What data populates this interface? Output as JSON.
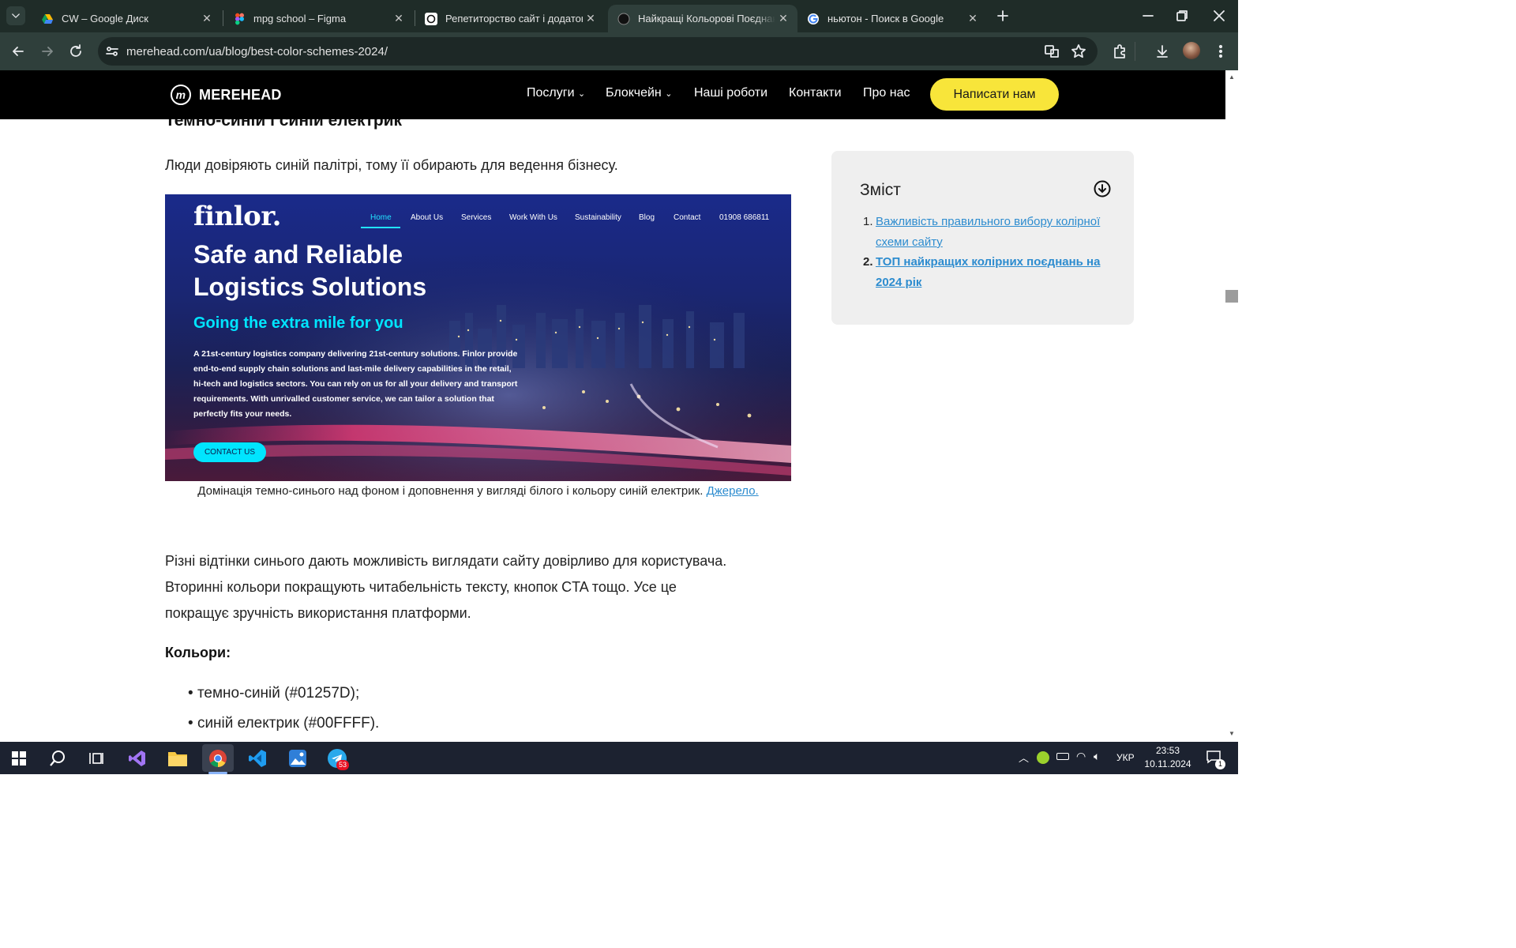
{
  "browser": {
    "tabs": [
      {
        "title": "CW – Google Диск",
        "icon": "google-drive-icon"
      },
      {
        "title": "mpg school – Figma",
        "icon": "figma-icon"
      },
      {
        "title": "Репетиторство сайт і додаток",
        "icon": "openai-icon"
      },
      {
        "title": "Найкращі Кольорові Поєднанн",
        "icon": "merehead-icon",
        "active": true
      },
      {
        "title": "ньютон - Поиск в Google",
        "icon": "google-icon"
      }
    ],
    "url": "merehead.com/ua/blog/best-color-schemes-2024/"
  },
  "site": {
    "logo": "MEREHEAD",
    "nav": [
      "Послуги",
      "Блокчейн",
      "Наші роботи",
      "Контакти",
      "Про нас"
    ],
    "cta": "Написати нам"
  },
  "article": {
    "heading": "Темно-синій і синій електрик",
    "intro": "Люди довіряють синій палітрі, тому її обирають для ведення бізнесу.",
    "caption": "Домінація темно-синього над фоном і доповнення у вигляді білого і кольору синій електрик.",
    "caption_link": "Джерело.",
    "para_lines": [
      "Різні відтінки синього дають можливість виглядати сайту довірливо для користувача.",
      "Вторинні кольори покращують читабельність тексту, кнопок CTA тощо. Усе це",
      "покращує зручність використання платформи."
    ],
    "colors_label": "Кольори:",
    "colors": [
      "темно-синій (#01257D);",
      "синій електрик (#00FFFF)."
    ]
  },
  "toc": {
    "title": "Зміст",
    "items": [
      {
        "num": "1.",
        "text": "Важливість правильного вибору колірної схеми сайту"
      },
      {
        "num": "2.",
        "text": "ТОП найкращих колірних поєднань на 2024 рік"
      }
    ]
  },
  "hero": {
    "brand": "finlor.",
    "nav": [
      "Home",
      "About Us",
      "Services",
      "Work With Us",
      "Sustainability",
      "Blog",
      "Contact",
      "01908 686811"
    ],
    "title_lines": [
      "Safe and Reliable",
      "Logistics Solutions"
    ],
    "subtitle": "Going the extra mile for you",
    "body_lines": [
      "A 21st-century logistics company delivering 21st-century solutions. Finlor provide",
      "end-to-end supply chain solutions and last-mile delivery capabilities in the retail,",
      "hi-tech and logistics sectors. You can rely on us for all your delivery and transport",
      "requirements. With unrivalled customer service, we can tailor a solution that",
      "perfectly fits your needs."
    ],
    "button": "CONTACT US"
  },
  "taskbar": {
    "lang": "УКР",
    "time": "23:53",
    "date": "10.11.2024",
    "telegram_badge": "53",
    "notif_count": "1"
  },
  "colors": {
    "accent_yellow": "#F8E53A",
    "link_blue": "#2D8CCF",
    "hero_cyan": "#00E5FF",
    "dark_blue": "#01257D"
  }
}
